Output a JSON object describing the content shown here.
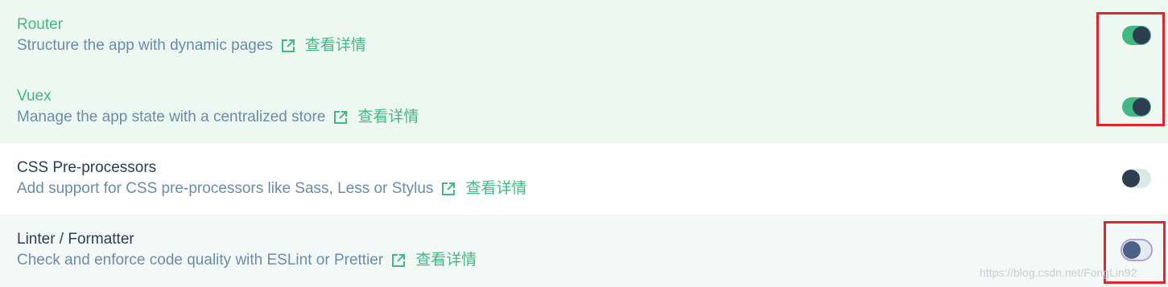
{
  "features": [
    {
      "name": "Router",
      "description": "Structure the app with dynamic pages",
      "link_icon": "external-link-icon",
      "more_label": "查看详情",
      "enabled": true
    },
    {
      "name": "Vuex",
      "description": "Manage the app state with a centralized store",
      "link_icon": "external-link-icon",
      "more_label": "查看详情",
      "enabled": true
    },
    {
      "name": "CSS Pre-processors",
      "description": "Add support for CSS pre-processors like Sass, Less or Stylus",
      "link_icon": "external-link-icon",
      "more_label": "查看详情",
      "enabled": false
    },
    {
      "name": "Linter / Formatter",
      "description": "Check and enforce code quality with ESLint or Prettier",
      "link_icon": "external-link-icon",
      "more_label": "查看详情",
      "enabled": false
    }
  ],
  "watermark": "https://blog.csdn.net/FongLin92",
  "colors": {
    "accent": "#42b983",
    "text_dark": "#2c3e50",
    "text_desc": "#6a8bad",
    "checked_bg": "#eef8f3",
    "highlight": "#e0262c"
  }
}
